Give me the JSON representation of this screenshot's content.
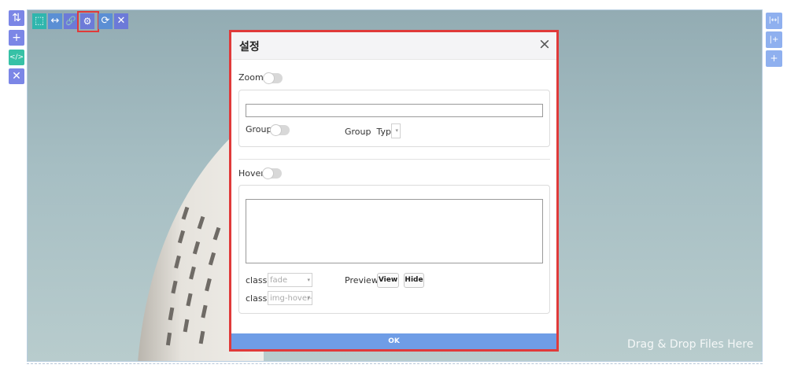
{
  "left_toolbar": {
    "move": "⇅",
    "add": "+",
    "code": "</>",
    "remove": "✕"
  },
  "right_toolbar": {
    "fit": "|↔|",
    "add_after": "|+",
    "add_below": "+"
  },
  "image_toolbar": {
    "image": "⬚",
    "width": "↔",
    "link": "🔗",
    "settings": "⚙",
    "refresh": "⟳",
    "close": "✕"
  },
  "editor": {
    "drop_hint": "Drag & Drop Files Here"
  },
  "modal": {
    "title": "설정",
    "close": "×",
    "zoom_label": "Zoom",
    "zoom_input": "",
    "group_label": "Group",
    "group_type_label": "Group  Type",
    "group_type_value": "",
    "hover_label": "Hover",
    "hover_text": "",
    "class1_label": "class",
    "class1_value": "fade",
    "class2_label": "class",
    "class2_value": "img-hover-t",
    "preview_label": "Preview",
    "view_button": "View",
    "hide_button": "Hide",
    "ok_button": "OK"
  },
  "colors": {
    "modal_border": "#e03a3a",
    "ok_bar": "#6f9de6",
    "left_buttons": "#7b86e6",
    "right_buttons": "#8fb0ef",
    "toolbar_teal": "#2fb6ad"
  }
}
